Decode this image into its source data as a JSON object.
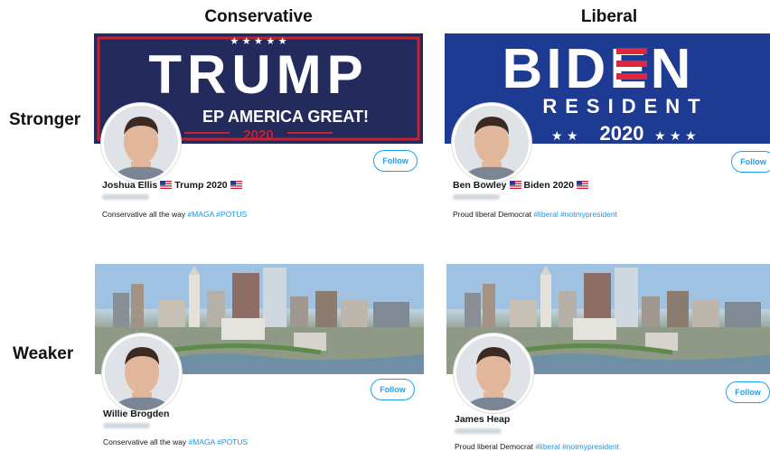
{
  "columns": {
    "left": "Conservative",
    "right": "Liberal"
  },
  "rows": {
    "top": "Stronger",
    "bottom": "Weaker"
  },
  "cards": [
    {
      "banner_type": "trump",
      "banner_text_main": "TRUMP",
      "banner_text_sub": "EP AMERICA GREAT!",
      "banner_text_year": "2020",
      "follow": "Follow",
      "name": "Joshua Ellis",
      "name_suffix": "Trump 2020",
      "bio_text": "Conservative all the way",
      "bio_tags": "#MAGA #POTUS"
    },
    {
      "banner_type": "biden",
      "banner_text_main": "BIDEN",
      "banner_text_sub": "RESIDENT",
      "banner_text_year": "2020",
      "follow": "Follow",
      "name": "Ben Bowley",
      "name_suffix": "Biden 2020",
      "bio_text": "Proud liberal Democrat",
      "bio_tags": "#liberal #notmypresident"
    },
    {
      "banner_type": "city",
      "follow": "Follow",
      "name": "Willie Brogden",
      "bio_text": "Conservative all the way",
      "bio_tags": "#MAGA #POTUS"
    },
    {
      "banner_type": "city",
      "follow": "Follow",
      "name": "James Heap",
      "bio_text": "Proud liberal Democrat",
      "bio_tags": "#liberal #notmypresident"
    }
  ],
  "colors": {
    "accent": "#1da1f2",
    "trump_navy": "#232a5c",
    "biden_blue": "#1d3b93",
    "red": "#c8202f"
  }
}
